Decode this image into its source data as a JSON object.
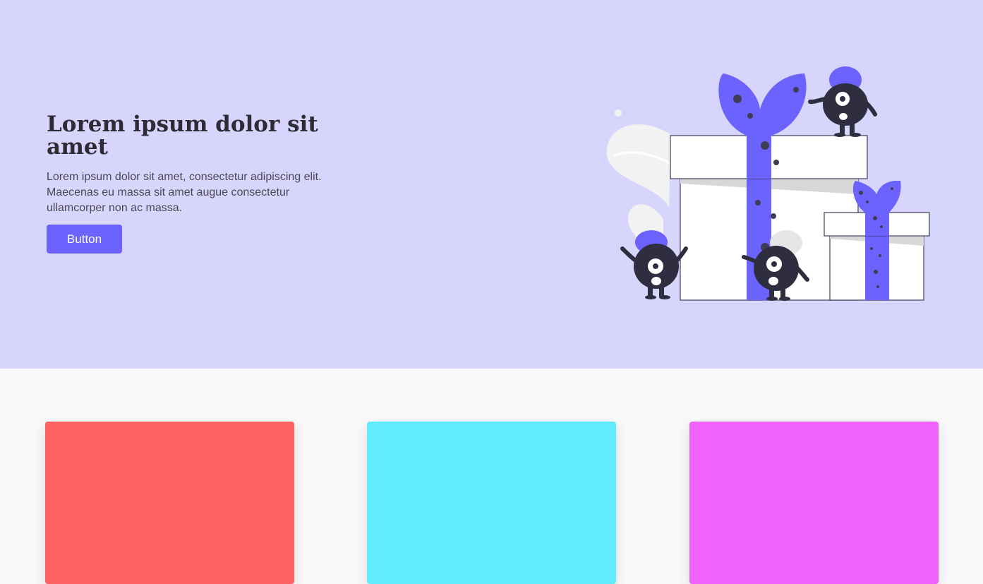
{
  "hero": {
    "title": "Lorem ipsum dolor sit amet",
    "description": "Lorem ipsum dolor sit amet, consectetur adipiscing elit. Maecenas eu massa sit amet augue consectetur ullamcorper non ac massa.",
    "button_label": "Button",
    "background": "#d8d5fd",
    "accent": "#6c63ff"
  },
  "illustration": {
    "name": "gift-boxes-with-monsters-illustration"
  },
  "cards": [
    {
      "color": "#ff6262"
    },
    {
      "color": "#62ebfc"
    },
    {
      "color": "#f062fc"
    }
  ]
}
